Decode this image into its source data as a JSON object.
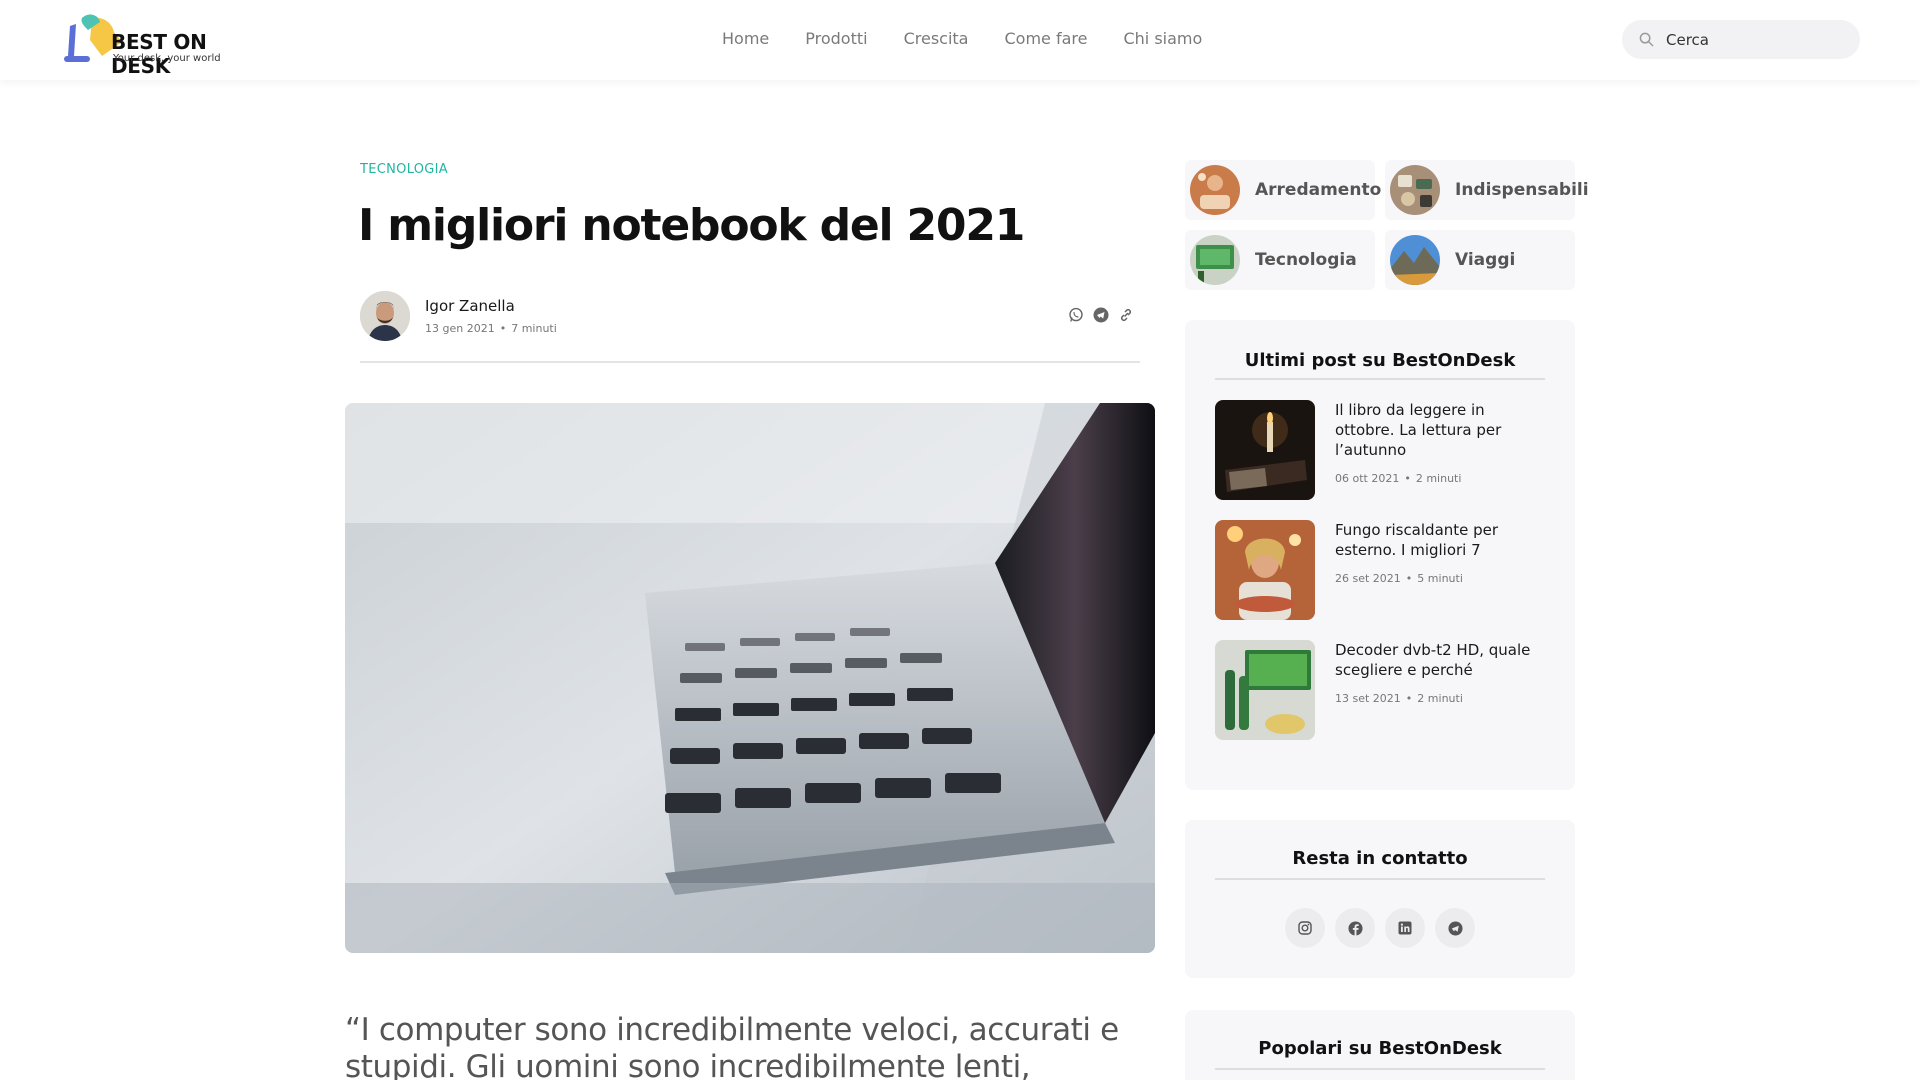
{
  "brand": {
    "name": "BEST ON DESK",
    "tagline": "Your desk, your world",
    "accent_color": "#21b5a0",
    "lamp_colors": [
      "#4ec3b4",
      "#f6c744",
      "#5b6fd6"
    ]
  },
  "nav": {
    "items": [
      {
        "label": "Home"
      },
      {
        "label": "Prodotti"
      },
      {
        "label": "Crescita"
      },
      {
        "label": "Come fare"
      },
      {
        "label": "Chi siamo"
      }
    ]
  },
  "search": {
    "placeholder": "Cerca",
    "icon": "search-icon"
  },
  "article": {
    "category": "TECNOLOGIA",
    "title": "I migliori notebook del 2021",
    "author": "Igor Zanella",
    "date": "13 gen 2021",
    "read_time": "7 minuti",
    "share_icons": [
      "whatsapp-icon",
      "telegram-icon",
      "link-icon"
    ],
    "quote": "“I computer sono incredibilmente veloci, accurati e stupidi. Gli uomini sono incredibilmente lenti, inaccurati e"
  },
  "sidebar": {
    "categories": [
      {
        "label": "Arredamento"
      },
      {
        "label": "Indispensabili"
      },
      {
        "label": "Tecnologia"
      },
      {
        "label": "Viaggi"
      }
    ],
    "latest": {
      "title": "Ultimi post su BestOnDesk",
      "posts": [
        {
          "title": "Il libro da leggere in ottobre. La lettura per l’autunno",
          "date": "06 ott 2021",
          "read_time": "2 minuti"
        },
        {
          "title": "Fungo riscaldante per esterno. I migliori 7",
          "date": "26 set 2021",
          "read_time": "5 minuti"
        },
        {
          "title": "Decoder dvb-t2 HD, quale scegliere e perché",
          "date": "13 set 2021",
          "read_time": "2 minuti"
        }
      ]
    },
    "contact": {
      "title": "Resta in contatto",
      "icons": [
        "instagram-icon",
        "facebook-icon",
        "linkedin-icon",
        "telegram-icon"
      ]
    },
    "popular": {
      "title": "Popolari su BestOnDesk"
    }
  }
}
